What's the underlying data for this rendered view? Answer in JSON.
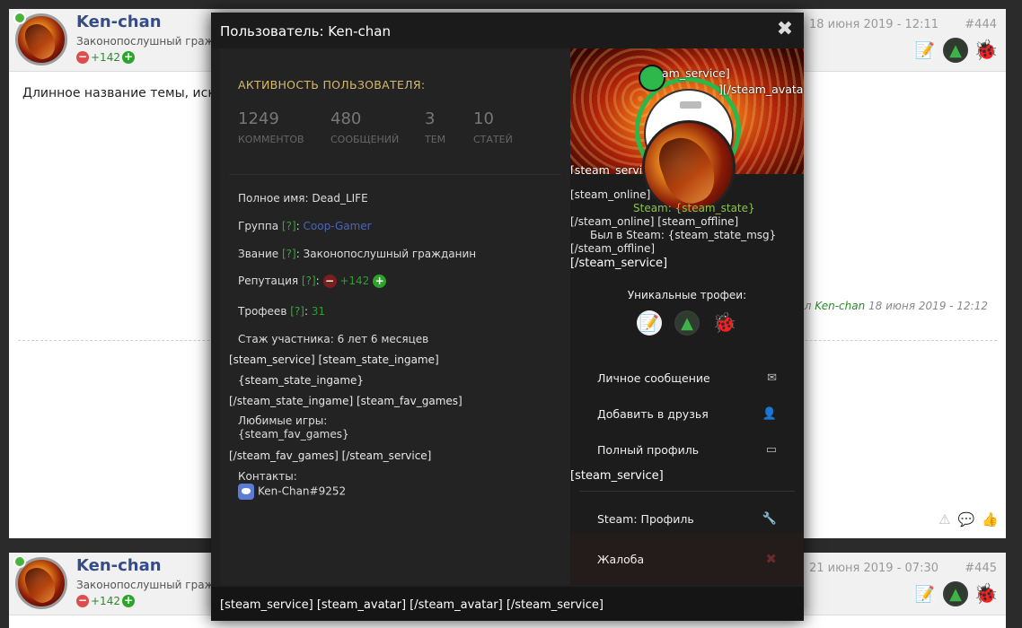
{
  "post1": {
    "name": "Ken-chan",
    "rank": "Законопослушный граждан",
    "rep": "+142",
    "date": "18 июня 2019 - 12:11",
    "num": "#444",
    "body": "Длинное название темы, иска",
    "edited_prefix": "ал",
    "edited_by": "Ken-chan",
    "edited_date": "18 июня 2019 - 12:12"
  },
  "post2": {
    "name": "Ken-chan",
    "rank": "Законопослушный граждан",
    "rep": "+142",
    "date": "21 июня 2019 - 07:30",
    "num": "#445"
  },
  "modal": {
    "title": "Пользователь: Ken-chan",
    "close": "✖",
    "activity_title": "АКТИВНОСТЬ ПОЛЬЗОВАТЕЛЯ:",
    "stats": [
      {
        "value": "1249",
        "label": "КОММЕНТОВ"
      },
      {
        "value": "480",
        "label": "СООБЩЕНИЙ"
      },
      {
        "value": "3",
        "label": "ТЕМ"
      },
      {
        "value": "10",
        "label": "СТАТЕЙ"
      }
    ],
    "full_name": "Полное имя: Dead_LIFE",
    "group_label": "Группа ",
    "group_q": "[?]",
    "group_value": "Coop-Gamer",
    "rank_label": "Звание ",
    "rank_q": "[?]",
    "rank_value": ": Законопослушный гражданин",
    "rep_label": "Репутация ",
    "rep_q": "[?]",
    "rep_value": "+142",
    "trophies_label": "Трофеев ",
    "trophies_q": "[?]",
    "trophies_value": "31",
    "experience": "Стаж участника: 6 лет 6 месяцев",
    "raw1": "[steam_service] [steam_state_ingame]",
    "raw2": "{steam_state_ingame}",
    "raw3": "[/steam_state_ingame] [steam_fav_games]",
    "fav_label": "Любимые игры:",
    "fav_value": "{steam_fav_games}",
    "raw4": "[/steam_fav_games] [/steam_service]",
    "contacts_label": "Контакты:",
    "discord": "Ken-Chan#9252",
    "footer": "[steam_service] [steam_avatar] [/steam_avatar] [/steam_service]"
  },
  "right": {
    "banner_txt1": "am_service]",
    "banner_txt2": "][/steam_avatar]",
    "banner_txt3": "[steam_servic",
    "online_open": "[steam_online]",
    "steam_state": "Steam: {steam_state}",
    "online_close": "[/steam_online] [steam_offline]",
    "was_in_steam": "Был в Steam: {steam_state_msg}",
    "offline_close": "[/steam_offline]",
    "service_close": "[/steam_service]",
    "unique_trophies": "Уникальные трофеи:",
    "menu": [
      {
        "label": "Личное сообщение",
        "icon": "✉"
      },
      {
        "label": "Добавить в друзья",
        "icon": "👤"
      },
      {
        "label": "Полный профиль",
        "icon": "▭"
      }
    ],
    "service_open": "[steam_service]",
    "steam_profile": "Steam: Профиль",
    "steam_icon": "🔧",
    "complaint": "Жалоба",
    "complaint_icon": "✖"
  },
  "icons": {
    "paper": "📝",
    "tree": "▲",
    "bug": "🐞"
  },
  "colors": {
    "online": "#49b33b",
    "reputation": "#2c8a2c",
    "group": "#4a65ba",
    "activity_title": "#d7b96d"
  }
}
